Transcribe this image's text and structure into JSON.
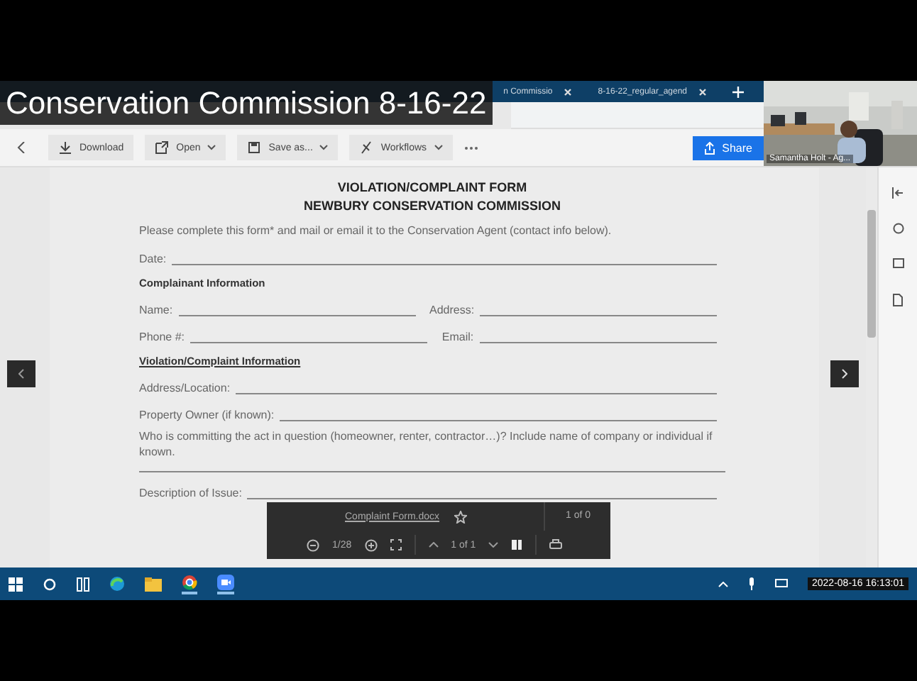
{
  "caption": "Conservation Commission 8-16-22",
  "browser_tabs": [
    {
      "label": "n Commissio",
      "selected": false
    },
    {
      "label": "8-16-22_regular_agend",
      "selected": false
    }
  ],
  "toolbar": [
    {
      "kind": "download",
      "label": "Download",
      "menu": false
    },
    {
      "kind": "open",
      "label": "Open",
      "menu": true
    },
    {
      "kind": "save",
      "label": "Save as...",
      "menu": true
    },
    {
      "kind": "workflow",
      "label": "Workflows",
      "menu": true
    }
  ],
  "share": "Share",
  "camera": {
    "name": "Samantha Holt - Ag..."
  },
  "document": {
    "title": "VIOLATION/COMPLAINT FORM",
    "subtitle": "NEWBURY CONSERVATION COMMISSION",
    "items": [
      {
        "kind": "text",
        "text": "Please complete this form* and mail or email it to the Conservation Agent (contact info below)."
      },
      {
        "kind": "fields",
        "labels": [
          "Date:"
        ]
      },
      {
        "kind": "heading",
        "text": "Complainant Information",
        "underlined": false
      },
      {
        "kind": "fields",
        "labels": [
          "Name:",
          "Address:"
        ]
      },
      {
        "kind": "fields",
        "labels": [
          "Phone #:",
          "Email:"
        ]
      },
      {
        "kind": "heading",
        "text": "Violation/Complaint Information",
        "underlined": true
      },
      {
        "kind": "fields",
        "labels": [
          "Address/Location:"
        ]
      },
      {
        "kind": "fields",
        "labels": [
          "Property Owner (if known):"
        ]
      },
      {
        "kind": "text",
        "text": "Who is committing the act in question (homeowner, renter, contractor…)? Include name of company or individual if known."
      },
      {
        "kind": "rule"
      },
      {
        "kind": "fields",
        "labels": [
          "Description of Issue:"
        ]
      }
    ]
  },
  "find_bar": {
    "file": "Complaint Form.docx",
    "matches": "1 of 0",
    "zoom": "1/28",
    "page": "1 of 1"
  },
  "clock": "2022-08-16 16:13:01"
}
